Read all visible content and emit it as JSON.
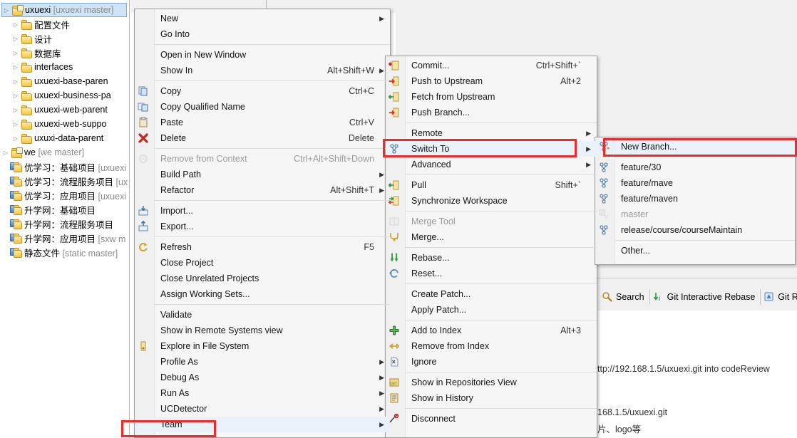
{
  "tree": {
    "selected_item": "uxuexi  [uxuexi master]",
    "items": [
      {
        "label": "uxuexi",
        "suffix": "  [uxuexi master]",
        "indent": 0,
        "arrow": true,
        "selected": true,
        "icon": "folder-repo-icon"
      },
      {
        "label": "配置文件",
        "suffix": "",
        "indent": 1,
        "arrow": true,
        "selected": false,
        "icon": "folder-icon"
      },
      {
        "label": "设计",
        "suffix": "",
        "indent": 1,
        "arrow": true,
        "selected": false,
        "icon": "folder-icon"
      },
      {
        "label": "数据库",
        "suffix": "",
        "indent": 1,
        "arrow": true,
        "selected": false,
        "icon": "folder-icon"
      },
      {
        "label": "interfaces",
        "suffix": "",
        "indent": 1,
        "arrow": true,
        "selected": false,
        "icon": "folder-icon"
      },
      {
        "label": "uxuexi-base-paren",
        "suffix": "",
        "indent": 1,
        "arrow": true,
        "selected": false,
        "icon": "folder-icon"
      },
      {
        "label": "uxuexi-business-pa",
        "suffix": "",
        "indent": 1,
        "arrow": true,
        "selected": false,
        "icon": "folder-icon"
      },
      {
        "label": "uxuexi-web-parent",
        "suffix": "",
        "indent": 1,
        "arrow": true,
        "selected": false,
        "icon": "folder-icon"
      },
      {
        "label": "uxuexi-web-suppo",
        "suffix": "",
        "indent": 1,
        "arrow": true,
        "selected": false,
        "icon": "folder-icon"
      },
      {
        "label": "uxuxi-data-parent",
        "suffix": "",
        "indent": 1,
        "arrow": true,
        "selected": false,
        "icon": "folder-icon"
      },
      {
        "label": "we",
        "suffix": "  [we master]",
        "indent": 0,
        "arrow": true,
        "selected": false,
        "icon": "folder-repo-icon"
      },
      {
        "label": "优学习：基础项目",
        "suffix": "  [uxuexi",
        "indent": 0,
        "arrow": false,
        "selected": false,
        "icon": "project-icon"
      },
      {
        "label": "优学习：流程服务项目",
        "suffix": "  [ux",
        "indent": 0,
        "arrow": false,
        "selected": false,
        "icon": "project-icon"
      },
      {
        "label": "优学习：应用项目",
        "suffix": "  [uxuexi",
        "indent": 0,
        "arrow": false,
        "selected": false,
        "icon": "project-icon"
      },
      {
        "label": "升学网：基础项目",
        "suffix": "",
        "indent": 0,
        "arrow": false,
        "selected": false,
        "icon": "project-icon"
      },
      {
        "label": "升学网：流程服务项目",
        "suffix": "",
        "indent": 0,
        "arrow": false,
        "selected": false,
        "icon": "project-icon"
      },
      {
        "label": "升学网：应用项目",
        "suffix": "  [sxw m",
        "indent": 0,
        "arrow": false,
        "selected": false,
        "icon": "project-icon"
      },
      {
        "label": "静态文件",
        "suffix": "  [static master]",
        "indent": 0,
        "arrow": false,
        "selected": false,
        "icon": "project-icon"
      }
    ]
  },
  "context_menu": {
    "items": [
      {
        "label": "New",
        "accel": "",
        "submenu": true,
        "icon": "",
        "disabled": false,
        "sep_after": false
      },
      {
        "label": "Go Into",
        "accel": "",
        "submenu": false,
        "icon": "",
        "disabled": false,
        "sep_after": true
      },
      {
        "label": "Open in New Window",
        "accel": "",
        "submenu": false,
        "icon": "",
        "disabled": false,
        "sep_after": false
      },
      {
        "label": "Show In",
        "accel": "Alt+Shift+W",
        "submenu": true,
        "icon": "",
        "disabled": false,
        "sep_after": true
      },
      {
        "label": "Copy",
        "accel": "Ctrl+C",
        "submenu": false,
        "icon": "copy-icon",
        "disabled": false,
        "sep_after": false
      },
      {
        "label": "Copy Qualified Name",
        "accel": "",
        "submenu": false,
        "icon": "copy-qualified-icon",
        "disabled": false,
        "sep_after": false
      },
      {
        "label": "Paste",
        "accel": "Ctrl+V",
        "submenu": false,
        "icon": "paste-icon",
        "disabled": false,
        "sep_after": false
      },
      {
        "label": "Delete",
        "accel": "Delete",
        "submenu": false,
        "icon": "delete-icon",
        "disabled": false,
        "sep_after": true
      },
      {
        "label": "Remove from Context",
        "accel": "Ctrl+Alt+Shift+Down",
        "submenu": false,
        "icon": "remove-context-icon",
        "disabled": true,
        "sep_after": false
      },
      {
        "label": "Build Path",
        "accel": "",
        "submenu": true,
        "icon": "",
        "disabled": false,
        "sep_after": false
      },
      {
        "label": "Refactor",
        "accel": "Alt+Shift+T",
        "submenu": true,
        "icon": "",
        "disabled": false,
        "sep_after": true
      },
      {
        "label": "Import...",
        "accel": "",
        "submenu": false,
        "icon": "import-icon",
        "disabled": false,
        "sep_after": false
      },
      {
        "label": "Export...",
        "accel": "",
        "submenu": false,
        "icon": "export-icon",
        "disabled": false,
        "sep_after": true
      },
      {
        "label": "Refresh",
        "accel": "F5",
        "submenu": false,
        "icon": "refresh-icon",
        "disabled": false,
        "sep_after": false
      },
      {
        "label": "Close Project",
        "accel": "",
        "submenu": false,
        "icon": "",
        "disabled": false,
        "sep_after": false
      },
      {
        "label": "Close Unrelated Projects",
        "accel": "",
        "submenu": false,
        "icon": "",
        "disabled": false,
        "sep_after": false
      },
      {
        "label": "Assign Working Sets...",
        "accel": "",
        "submenu": false,
        "icon": "",
        "disabled": false,
        "sep_after": true
      },
      {
        "label": "Validate",
        "accel": "",
        "submenu": false,
        "icon": "",
        "disabled": false,
        "sep_after": false
      },
      {
        "label": "Show in Remote Systems view",
        "accel": "",
        "submenu": false,
        "icon": "",
        "disabled": false,
        "sep_after": false
      },
      {
        "label": "Explore in File System",
        "accel": "",
        "submenu": false,
        "icon": "explore-icon",
        "disabled": false,
        "sep_after": false
      },
      {
        "label": "Profile As",
        "accel": "",
        "submenu": true,
        "icon": "",
        "disabled": false,
        "sep_after": false
      },
      {
        "label": "Debug As",
        "accel": "",
        "submenu": true,
        "icon": "",
        "disabled": false,
        "sep_after": false
      },
      {
        "label": "Run As",
        "accel": "",
        "submenu": true,
        "icon": "",
        "disabled": false,
        "sep_after": false
      },
      {
        "label": "UCDetector",
        "accel": "",
        "submenu": true,
        "icon": "",
        "disabled": false,
        "sep_after": false
      },
      {
        "label": "Team",
        "accel": "",
        "submenu": true,
        "icon": "",
        "disabled": false,
        "sep_after": false,
        "highlighted": true
      }
    ]
  },
  "team_menu": {
    "items": [
      {
        "label": "Commit...",
        "accel": "Ctrl+Shift+`",
        "submenu": false,
        "icon": "commit-icon",
        "disabled": false,
        "sep_after": false
      },
      {
        "label": "Push to Upstream",
        "accel": "Alt+2",
        "submenu": false,
        "icon": "push-upstream-icon",
        "disabled": false,
        "sep_after": false
      },
      {
        "label": "Fetch from Upstream",
        "accel": "",
        "submenu": false,
        "icon": "fetch-icon",
        "disabled": false,
        "sep_after": false
      },
      {
        "label": "Push Branch...",
        "accel": "",
        "submenu": false,
        "icon": "push-branch-icon",
        "disabled": false,
        "sep_after": true
      },
      {
        "label": "Remote",
        "accel": "",
        "submenu": true,
        "icon": "",
        "disabled": false,
        "sep_after": false
      },
      {
        "label": "Switch To",
        "accel": "",
        "submenu": true,
        "icon": "switch-to-icon",
        "disabled": false,
        "sep_after": false,
        "highlighted": true
      },
      {
        "label": "Advanced",
        "accel": "",
        "submenu": true,
        "icon": "",
        "disabled": false,
        "sep_after": true
      },
      {
        "label": "Pull",
        "accel": "Shift+`",
        "submenu": false,
        "icon": "pull-icon",
        "disabled": false,
        "sep_after": false
      },
      {
        "label": "Synchronize Workspace",
        "accel": "",
        "submenu": false,
        "icon": "synchronize-icon",
        "disabled": false,
        "sep_after": true
      },
      {
        "label": "Merge Tool",
        "accel": "",
        "submenu": false,
        "icon": "merge-tool-icon",
        "disabled": true,
        "sep_after": false
      },
      {
        "label": "Merge...",
        "accel": "",
        "submenu": false,
        "icon": "merge-icon",
        "disabled": false,
        "sep_after": true
      },
      {
        "label": "Rebase...",
        "accel": "",
        "submenu": false,
        "icon": "rebase-icon",
        "disabled": false,
        "sep_after": false
      },
      {
        "label": "Reset...",
        "accel": "",
        "submenu": false,
        "icon": "reset-icon",
        "disabled": false,
        "sep_after": true
      },
      {
        "label": "Create Patch...",
        "accel": "",
        "submenu": false,
        "icon": "",
        "disabled": false,
        "sep_after": false
      },
      {
        "label": "Apply Patch...",
        "accel": "",
        "submenu": false,
        "icon": "",
        "disabled": false,
        "sep_after": true
      },
      {
        "label": "Add to Index",
        "accel": "Alt+3",
        "submenu": false,
        "icon": "add-index-icon",
        "disabled": false,
        "sep_after": false
      },
      {
        "label": "Remove from Index",
        "accel": "",
        "submenu": false,
        "icon": "remove-index-icon",
        "disabled": false,
        "sep_after": false
      },
      {
        "label": "Ignore",
        "accel": "",
        "submenu": false,
        "icon": "ignore-icon",
        "disabled": false,
        "sep_after": true
      },
      {
        "label": "Show in Repositories View",
        "accel": "",
        "submenu": false,
        "icon": "repositories-icon",
        "disabled": false,
        "sep_after": false
      },
      {
        "label": "Show in History",
        "accel": "",
        "submenu": false,
        "icon": "history-icon",
        "disabled": false,
        "sep_after": true
      },
      {
        "label": "Disconnect",
        "accel": "",
        "submenu": false,
        "icon": "disconnect-icon",
        "disabled": false,
        "sep_after": false
      }
    ]
  },
  "switch_to_menu": {
    "items": [
      {
        "label": "New Branch...",
        "icon": "new-branch-icon",
        "disabled": false,
        "sep_after": true,
        "highlighted": true
      },
      {
        "label": "feature/30",
        "icon": "branch-icon",
        "disabled": false,
        "sep_after": false
      },
      {
        "label": "feature/mave",
        "icon": "branch-icon",
        "disabled": false,
        "sep_after": false
      },
      {
        "label": "feature/maven",
        "icon": "branch-icon",
        "disabled": false,
        "sep_after": false
      },
      {
        "label": "master",
        "icon": "current-branch-icon",
        "disabled": true,
        "sep_after": false
      },
      {
        "label": "release/course/courseMaintain",
        "icon": "branch-icon",
        "disabled": false,
        "sep_after": true
      },
      {
        "label": "Other...",
        "icon": "",
        "disabled": false,
        "sep_after": false
      }
    ]
  },
  "right_panel": {
    "tabs": [
      {
        "label": "Search",
        "icon": "search-icon"
      },
      {
        "label": "Git Interactive Rebase",
        "icon": "rebase-tab-icon"
      },
      {
        "label": "Git Ref",
        "icon": "git-reflog-icon"
      }
    ],
    "background_text": [
      "ttp://192.168.1.5/uxuexi.git into codeReview",
      "168.1.5/uxuexi.git",
      "片、logo等"
    ]
  },
  "colors": {
    "highlight_box": "#ee2b2b",
    "menu_bg": "#f6f6f6",
    "selection_bg": "#cfe4f7"
  }
}
